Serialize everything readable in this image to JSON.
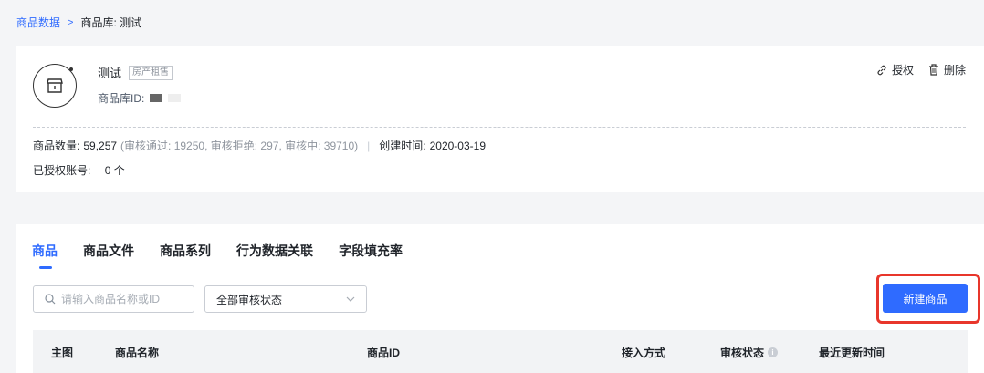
{
  "breadcrumb": {
    "parent": "商品数据",
    "separator": ">",
    "current": "商品库: 测试"
  },
  "library": {
    "name": "测试",
    "tag": "房产租售",
    "id_label": "商品库ID:",
    "actions": {
      "authorize": "授权",
      "delete": "删除"
    },
    "count_label": "商品数量:",
    "count_value": "59,257",
    "count_detail": "(审核通过: 19250, 审核拒绝: 297, 审核中: 39710)",
    "stat_divider": "|",
    "created_label": "创建时间:",
    "created_value": "2020-03-19",
    "accounts_label": "已授权账号:",
    "accounts_value": "0 个"
  },
  "tabs": [
    "商品",
    "商品文件",
    "商品系列",
    "行为数据关联",
    "字段填充率"
  ],
  "filters": {
    "search_placeholder": "请输入商品名称或ID",
    "status_selected": "全部审核状态"
  },
  "new_button_label": "新建商品",
  "table": {
    "columns": [
      "主图",
      "商品名称",
      "商品ID",
      "接入方式",
      "审核状态",
      "最近更新时间"
    ]
  },
  "colors": {
    "accent": "#2f6bff",
    "highlight": "#e8362b"
  },
  "icons": [
    "store-icon",
    "link-icon",
    "trash-icon",
    "search-icon",
    "chevron-down-icon",
    "info-icon"
  ]
}
